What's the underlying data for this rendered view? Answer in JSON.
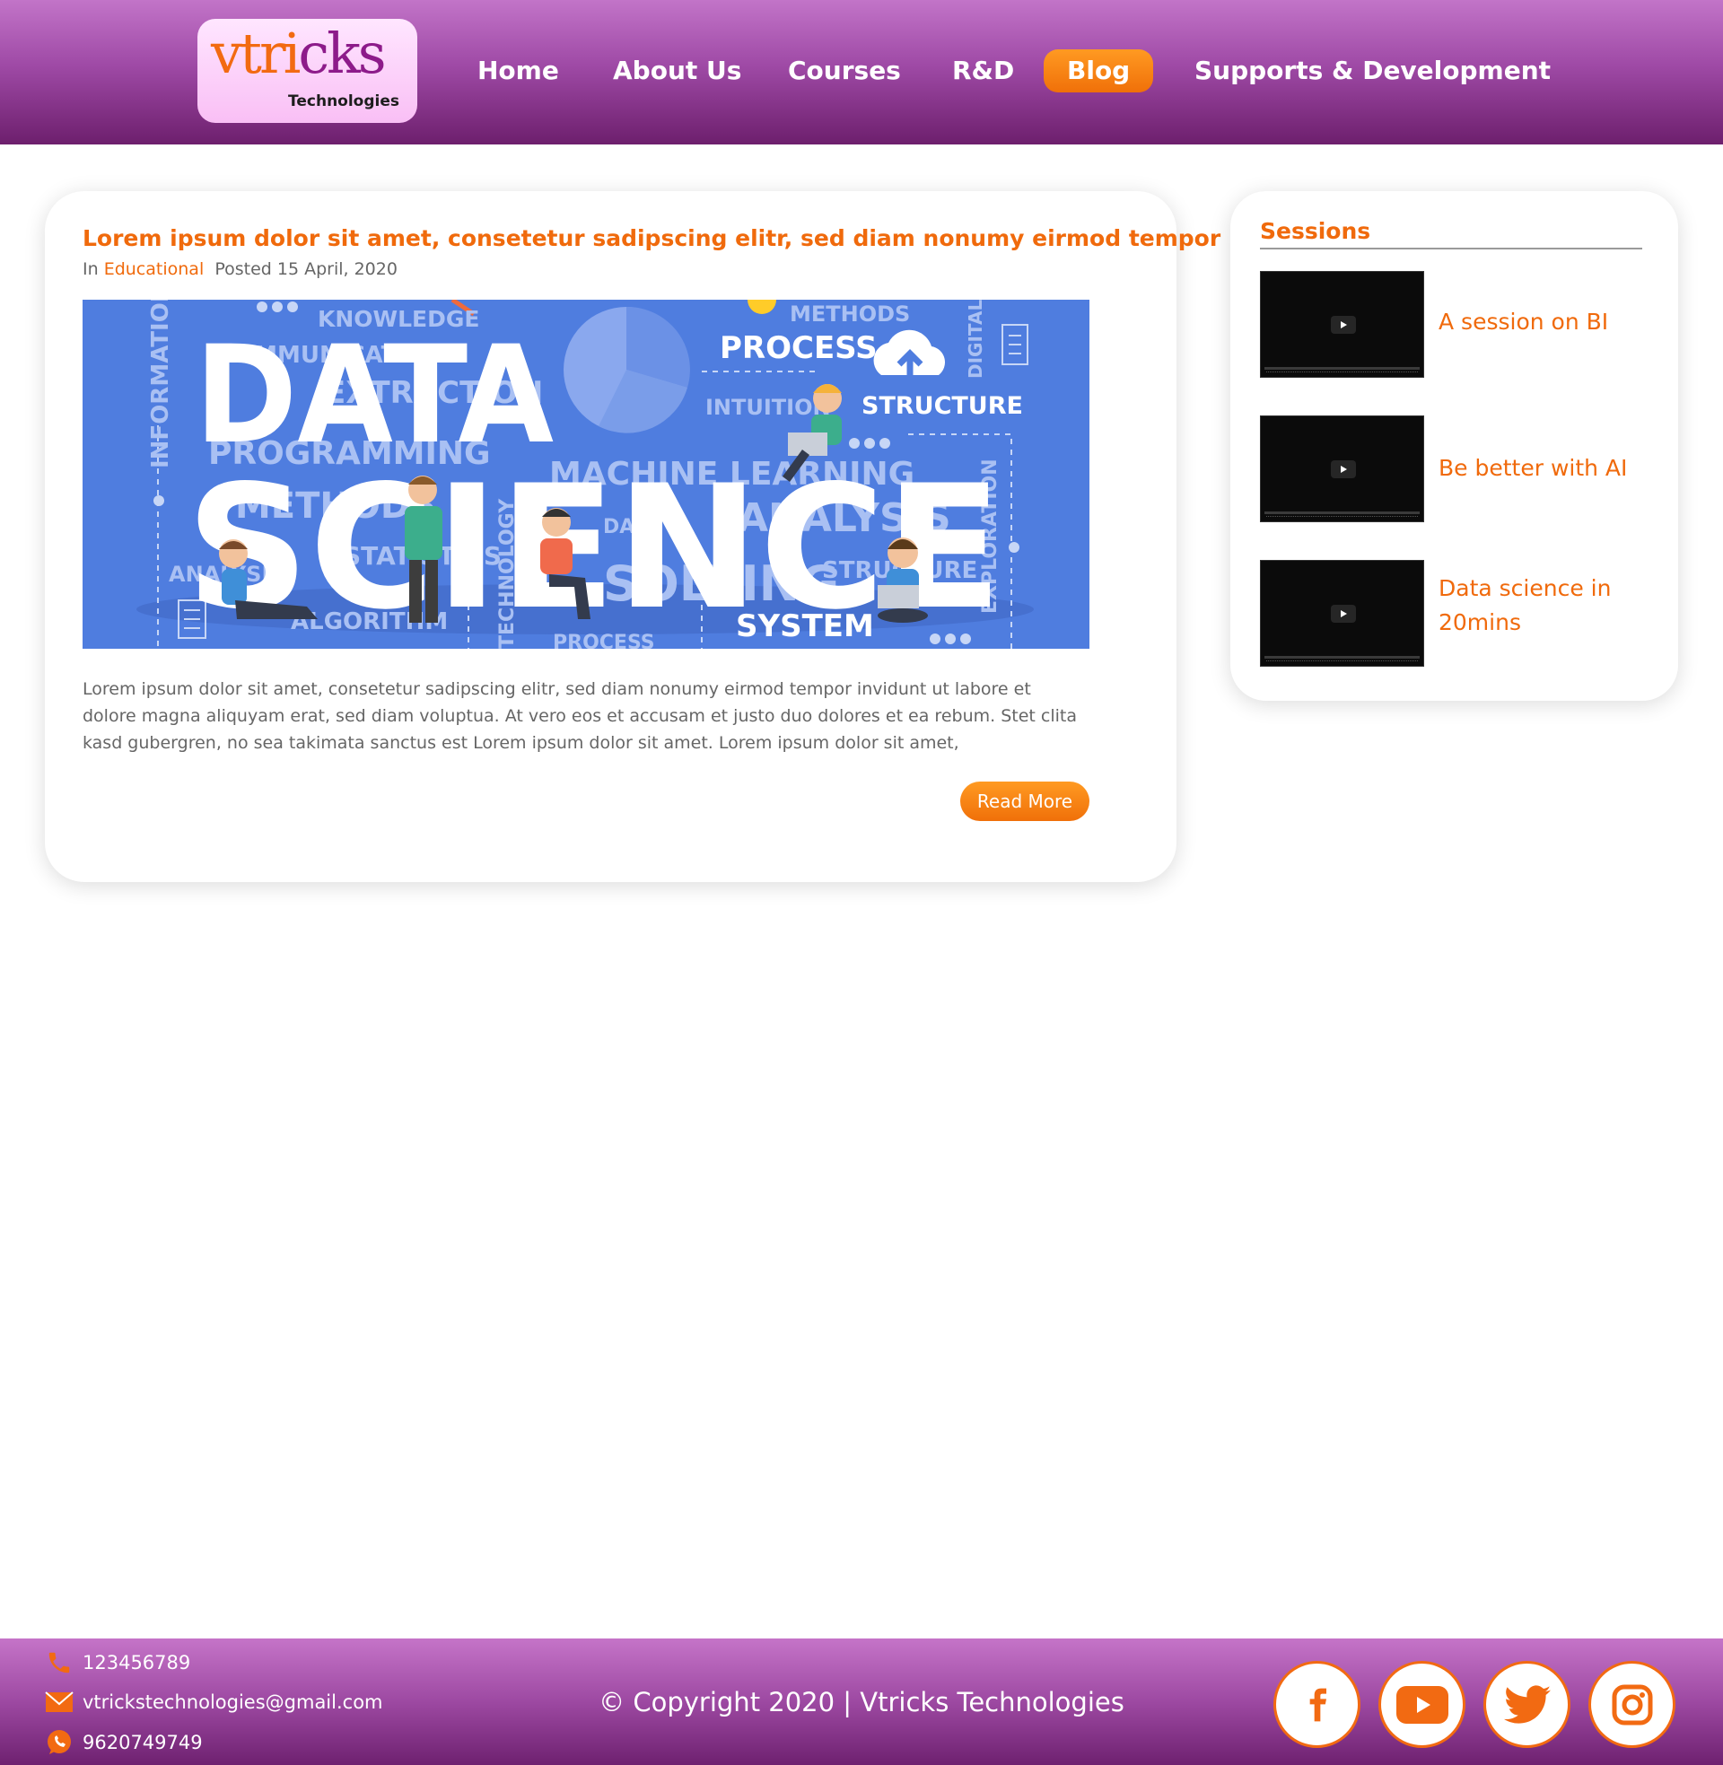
{
  "brand": {
    "logo_main": "vtri",
    "logo_accent": "cks",
    "logo_sub": "Technologies",
    "primary_color": "#f06a0c",
    "header_color": "#a14ea8"
  },
  "nav": {
    "home": "Home",
    "about": "About Us",
    "courses": "Courses",
    "rnd": "R&D",
    "blog": "Blog",
    "supports": "Supports & Development",
    "active": "Blog"
  },
  "post": {
    "title": "Lorem ipsum dolor sit amet, consetetur sadipscing elitr, sed diam nonumy eirmod tempor",
    "meta_in": "In",
    "category": "Educational",
    "posted": "Posted 15 April, 2020",
    "image": {
      "big_line1": "DATA",
      "big_line2": "SCIENCE",
      "words": {
        "knowledge": "KNOWLEDGE",
        "methods_top": "METHODS",
        "process_big": "PROCESS",
        "structure": "STRUCTURE",
        "intuition": "INTUITION",
        "information": "INFORMATION",
        "digital": "DIGITAL",
        "programming": "PROGRAMMING",
        "communication": "COMMUNICATION",
        "extraction": "EXTRACTION",
        "methods": "METHODS",
        "statistics": "STATISTICS",
        "analysis_left": "ANALYSIS",
        "algorithm": "ALGORITHM",
        "technology": "TECHNOLOGY",
        "machine_learning": "MACHINE LEARNING",
        "analysis": "ANALYSIS",
        "exploration": "EXPLORATION",
        "solving": "SOLVING",
        "structure_small": "STRUCTURE",
        "system": "SYSTEM",
        "process_bottom": "PROCESS",
        "data": "DATA"
      }
    },
    "excerpt": "Lorem ipsum dolor sit amet, consetetur sadipscing elitr, sed diam nonumy eirmod tempor invidunt ut labore et dolore magna aliquyam erat, sed diam voluptua. At vero eos et accusam et justo duo dolores et ea rebum. Stet clita kasd gubergren, no sea takimata sanctus est Lorem ipsum dolor sit amet. Lorem ipsum dolor sit amet,",
    "read_more": "Read More"
  },
  "sessions": {
    "title": "Sessions",
    "items": [
      {
        "label": "A session on  BI"
      },
      {
        "label": "Be better with AI"
      },
      {
        "label": "Data science in 20mins"
      }
    ]
  },
  "footer": {
    "phone": "123456789",
    "email": "vtrickstechnologies@gmail.com",
    "whatsapp": "9620749749",
    "copyright": "© Copyright 2020 | Vtricks Technologies",
    "social": [
      "facebook",
      "youtube",
      "twitter",
      "instagram"
    ]
  }
}
